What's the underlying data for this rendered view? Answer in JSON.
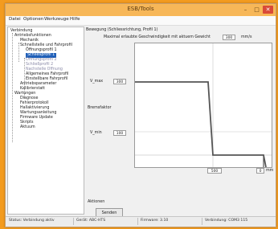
{
  "window": {
    "title": "ESB/Tools"
  },
  "menu": {
    "items": [
      "Datei",
      "Optionen",
      "Werkzeuge",
      "Hilfe"
    ]
  },
  "tree": {
    "root": "Verbindung",
    "items": [
      "Antriebsfunktionen",
      "Mechanik",
      "Schnellstelle und Fahrprofil",
      "Öffnungsprofil 1",
      "Schließprofil 1",
      "Öffnungsprofil 2",
      "Schließprofil 2",
      "Nachstelle Offnung",
      "Allgemeines Fahrprofil",
      "Einstellbare Fahrprofil",
      "Antriebsparameter",
      "Kalibrierstatt",
      "Wartungen",
      "Diagnose",
      "Fehlerprotokoll",
      "Hallaktivierung",
      "Wartungsanleitung",
      "Firmware Update",
      "Skripts",
      "Aktuum"
    ]
  },
  "main": {
    "group_title": "Bewegung (Schliessrichtung, Profil 1)",
    "max_speed_label": "Maximal erlaubte Geschwindigkeit mit aktuem Gewicht",
    "max_speed_value": "300",
    "max_speed_unit": "mm/s",
    "v_upper_label": "V_max",
    "v_upper_value": "300",
    "section_label": "Bremsfaktor",
    "v_lower_label": "V_min",
    "v_lower_value": "100",
    "x_left_value": "500",
    "x_right_value": "0",
    "x_unit": "mm",
    "actions_label": "Aktionen",
    "apply_button": "Senden"
  },
  "status": {
    "items": [
      "Status: Verbindung aktiv",
      "Gerät: ABC-HTS",
      "Firmware: 3.10",
      "Verbindung: COM3 115"
    ]
  },
  "colors": {
    "accent": "#f39b1f",
    "selection": "#1f5fb8"
  },
  "icons": [
    "minimize-icon",
    "maximize-icon",
    "close-icon"
  ]
}
